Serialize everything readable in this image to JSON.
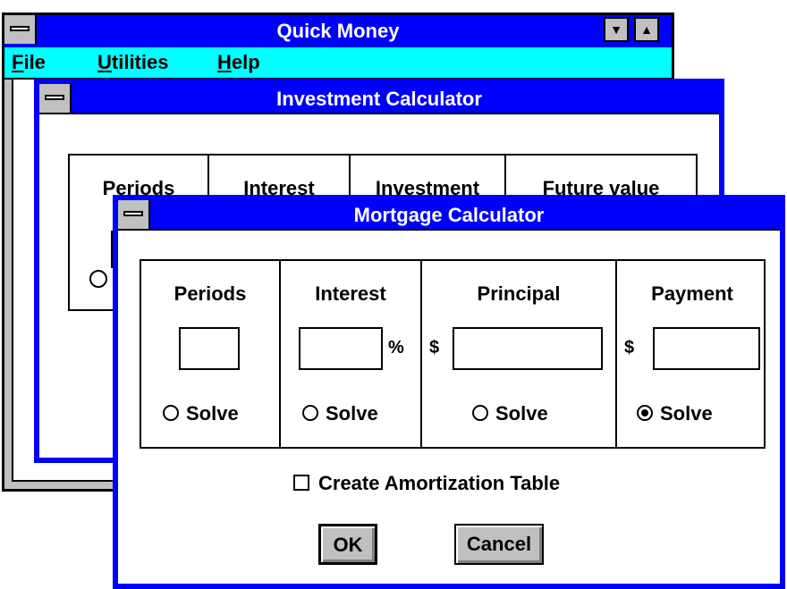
{
  "quick_money": {
    "title": "Quick Money",
    "menu": {
      "file": "File",
      "utilities": "Utilities",
      "help": "Help"
    },
    "file_first": "F",
    "file_rest": "ile",
    "utilities_first": "U",
    "utilities_rest": "tilities",
    "help_first": "H",
    "help_rest": "elp"
  },
  "investment_calculator": {
    "title": "Investment Calculator",
    "columns": [
      "Periods",
      "Interest",
      "Investment",
      "Future value"
    ]
  },
  "mortgage_calculator": {
    "title": "Mortgage Calculator",
    "columns": [
      {
        "label": "Periods",
        "value": "",
        "prefix": "",
        "suffix": "",
        "solve_label": "Solve",
        "solve_selected": false
      },
      {
        "label": "Interest",
        "value": "",
        "prefix": "",
        "suffix": "%",
        "solve_label": "Solve",
        "solve_selected": false
      },
      {
        "label": "Principal",
        "value": "",
        "prefix": "$",
        "suffix": "",
        "solve_label": "Solve",
        "solve_selected": false
      },
      {
        "label": "Payment",
        "value": "",
        "prefix": "$",
        "suffix": "",
        "solve_label": "Solve",
        "solve_selected": true
      }
    ],
    "amortization_label": "Create Amortization Table",
    "amortization_checked": false,
    "ok_label": "OK",
    "cancel_label": "Cancel"
  }
}
